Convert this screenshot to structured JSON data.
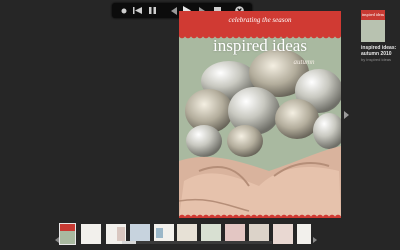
{
  "player": {
    "controls": [
      "record-dot-icon",
      "skip-back-icon",
      "pause-icon",
      "previous-icon",
      "play-icon",
      "next-icon",
      "stop-icon",
      "close-icon"
    ]
  },
  "cover": {
    "kicker": "celebrating the season",
    "title": "inspired ideas",
    "season": "autumn",
    "colors": {
      "header": "#d03a33",
      "bg": "#a8b8a0"
    }
  },
  "side_panel": {
    "thumb_caption": "inspired ideas",
    "title": "inspired ideas: autumn 2010",
    "byline": "by inspired ideas"
  },
  "thumbnails": [
    "cover",
    "spread-1",
    "spread-2",
    "spread-3",
    "spread-4",
    "spread-5",
    "spread-6",
    "spread-7",
    "spread-8",
    "spread-9",
    "spread-10",
    "spread-11",
    "spread-12",
    "spread-13",
    "spread-14"
  ]
}
